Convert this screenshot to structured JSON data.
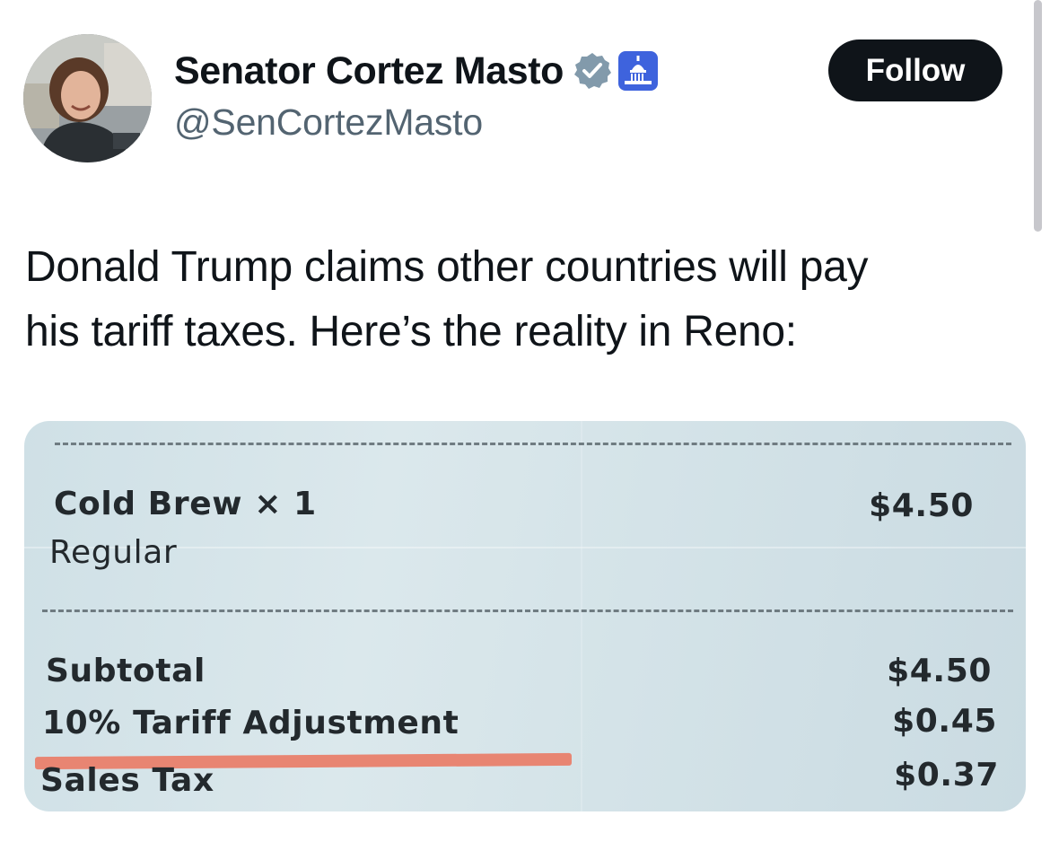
{
  "author": {
    "display_name": "Senator Cortez Masto",
    "handle": "@SenCortezMasto",
    "verified_badge_icon": "verified-badge-icon",
    "affiliation_icon": "capitol-dome-icon"
  },
  "follow_button": {
    "label": "Follow"
  },
  "tweet": {
    "lines": [
      "Donald Trump claims other countries will pay",
      "his tariff taxes. Here’s the reality in Reno:"
    ]
  },
  "receipt": {
    "item": {
      "name": "Cold Brew × 1",
      "variant": "Regular",
      "price": "$4.50"
    },
    "totals": [
      {
        "label": "Subtotal",
        "amount": "$4.50"
      },
      {
        "label": "10% Tariff Adjustment",
        "amount": "$0.45"
      },
      {
        "label": "Sales Tax",
        "amount": "$0.37"
      }
    ],
    "highlight_color": "#e9806b"
  },
  "colors": {
    "text_primary": "#0f1419",
    "text_secondary": "#536471",
    "button_bg": "#0f1419",
    "verified_blue_gray": "#829aab"
  }
}
